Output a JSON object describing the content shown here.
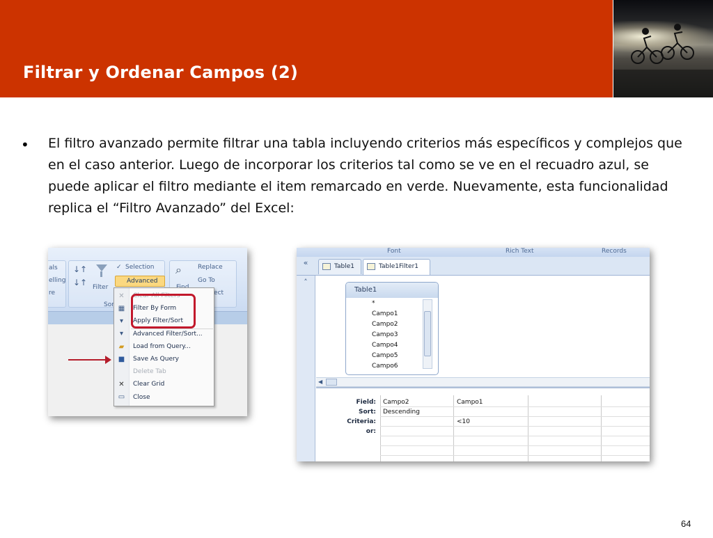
{
  "slide": {
    "title": "Filtrar y Ordenar Campos (2)",
    "bullet": "•",
    "body": "El filtro avanzado permite filtrar una tabla incluyendo criterios más específicos y complejos que en el caso anterior. Luego de incorporar los criterios tal como se ve en el recuadro azul, se puede aplicar el filtro mediante el item remarcado en verde. Nuevamente, esta funcionalidad replica el “Filtro Avanzado” del Excel:",
    "page_number": "64"
  },
  "left_shot": {
    "ribbon": {
      "totals_partial": "als",
      "spelling_partial": "elling",
      "more_partial": "re",
      "filter_label": "Filter",
      "selection_label": "Selection",
      "advanced_label": "Advanced",
      "group_partial": "Sort",
      "find_partial": "Find",
      "replace_label": "Replace",
      "goto_label": "Go To",
      "select_partial": "elect"
    },
    "menu": [
      {
        "label": "Clear All Filters",
        "enabled": false
      },
      {
        "label": "Filter By Form",
        "enabled": true
      },
      {
        "label": "Apply Filter/Sort",
        "enabled": true
      },
      {
        "label": "Advanced Filter/Sort...",
        "enabled": true
      },
      {
        "label": "Load from Query...",
        "enabled": true
      },
      {
        "label": "Save As Query",
        "enabled": true
      },
      {
        "label": "Delete Tab",
        "enabled": false
      },
      {
        "label": "Clear Grid",
        "enabled": true
      },
      {
        "label": "Close",
        "enabled": true
      }
    ],
    "highlight_color": "#c2182b"
  },
  "right_shot": {
    "ribbon_groups": [
      "Font",
      "Rich Text",
      "Records"
    ],
    "nav_buttons": [
      "«",
      "˄"
    ],
    "tabs": [
      "Table1",
      "Table1Filter1"
    ],
    "table_box": {
      "title": "Table1",
      "fields": [
        "*",
        "Campo1",
        "Campo2",
        "Campo3",
        "Campo4",
        "Campo5",
        "Campo6"
      ]
    },
    "grid": {
      "row_labels": [
        "Field:",
        "Sort:",
        "Criteria:",
        "or:"
      ],
      "columns": [
        {
          "field": "Campo2",
          "sort": "Descending",
          "criteria": ""
        },
        {
          "field": "Campo1",
          "sort": "",
          "criteria": "<10"
        }
      ]
    }
  },
  "colors": {
    "header_red": "#cc3300",
    "ribbon_blue": "#d7e4f6"
  }
}
